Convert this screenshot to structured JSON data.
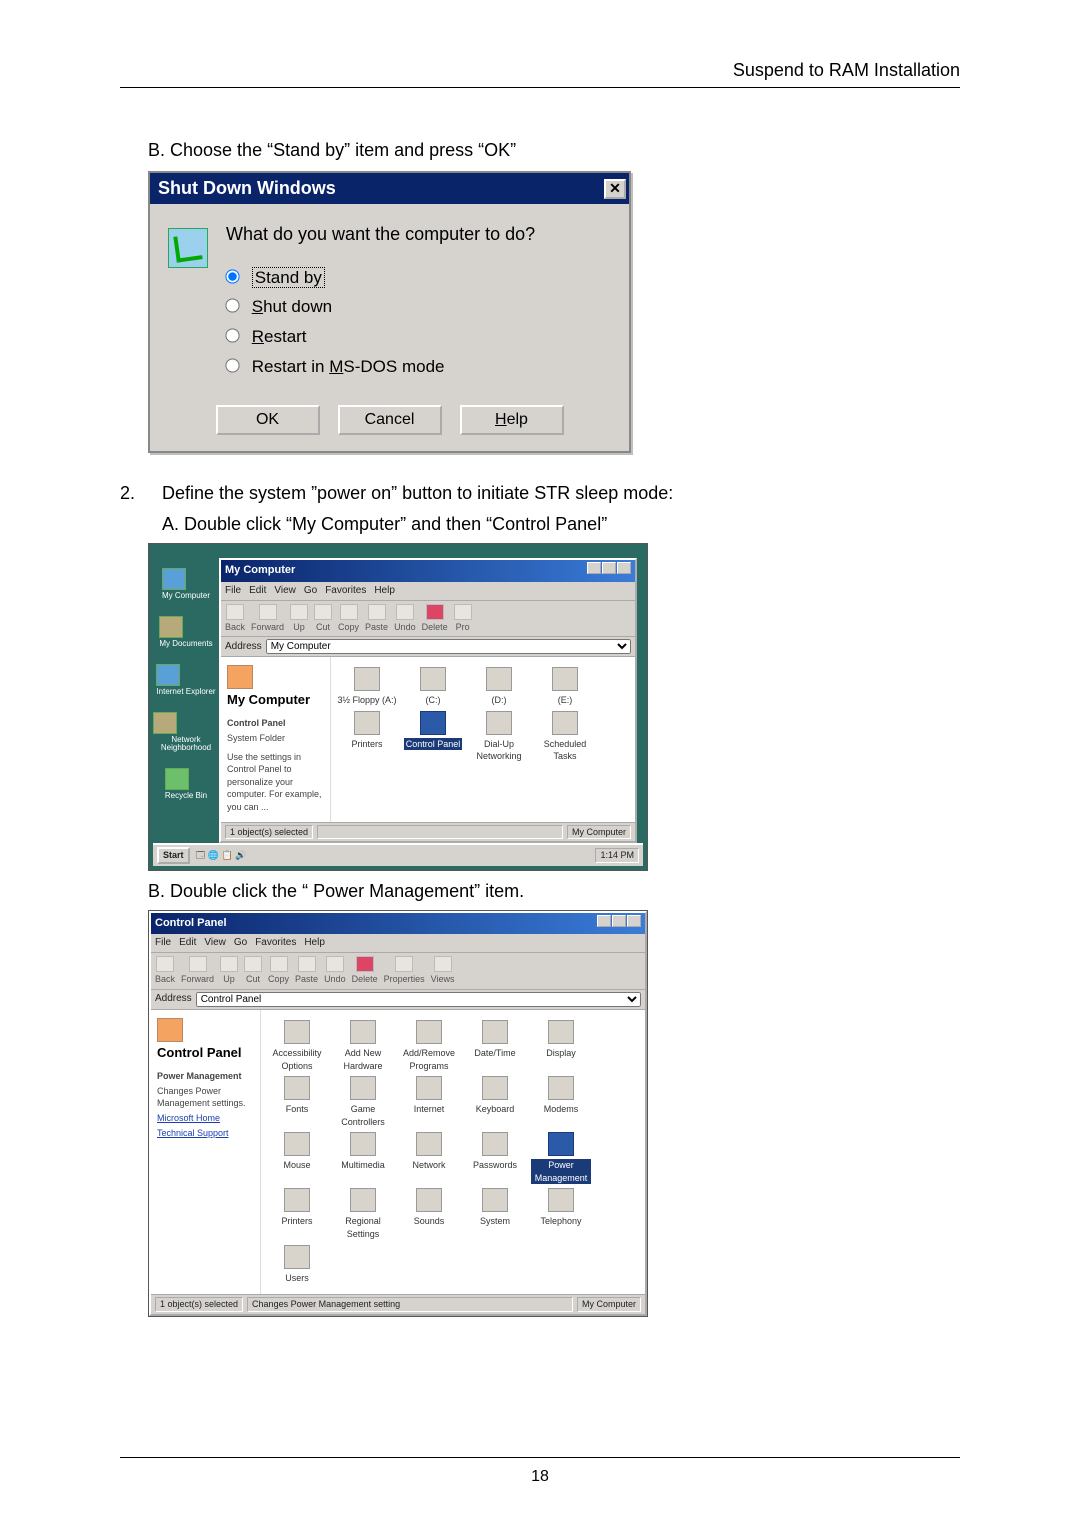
{
  "header": {
    "right": "Suspend to RAM Installation"
  },
  "step_b": "B.  Choose the “Stand by” item and press “OK”",
  "shutdown": {
    "title": "Shut Down Windows",
    "question": "What do you want the computer to do?",
    "opt_standby_plain": "Stand by",
    "opt_shutdown_pre": "S",
    "opt_shutdown_rest": "hut down",
    "opt_restart_pre": "R",
    "opt_restart_rest": "estart",
    "opt_msdos_pre": "Restart in ",
    "opt_msdos_u": "M",
    "opt_msdos_rest": "S-DOS mode",
    "btn_ok": "OK",
    "btn_cancel": "Cancel",
    "btn_help_pre": "H",
    "btn_help_rest": "elp"
  },
  "step2": {
    "num": "2.",
    "text": "Define the system ”power on” button to initiate STR sleep mode:",
    "a": "A.  Double click “My Computer” and then “Control Panel”"
  },
  "mycomp": {
    "title": "My Computer",
    "menus": [
      "File",
      "Edit",
      "View",
      "Go",
      "Favorites",
      "Help"
    ],
    "tools": [
      "Back",
      "Forward",
      "Up",
      "Cut",
      "Copy",
      "Paste",
      "Undo",
      "Delete",
      "Pro"
    ],
    "address_label": "Address",
    "address_value": "My Computer",
    "side_title": "My Computer",
    "side_section": "Control Panel",
    "side_section_sub": "System Folder",
    "side_desc": "Use the settings in Control Panel to personalize your computer. For example, you can ...",
    "items": [
      {
        "label": "3½ Floppy (A:)"
      },
      {
        "label": "(C:)"
      },
      {
        "label": "(D:)"
      },
      {
        "label": "(E:)"
      },
      {
        "label": "Printers"
      },
      {
        "label": "Control Panel",
        "sel": true
      },
      {
        "label": "Dial-Up Networking"
      },
      {
        "label": "Scheduled Tasks"
      }
    ],
    "status_left": "1 object(s) selected",
    "status_right": "My Computer"
  },
  "sec_b2": "B.  Double click the “ Power Management” item.",
  "cpanel": {
    "title": "Control Panel",
    "menus": [
      "File",
      "Edit",
      "View",
      "Go",
      "Favorites",
      "Help"
    ],
    "tools": [
      "Back",
      "Forward",
      "Up",
      "Cut",
      "Copy",
      "Paste",
      "Undo",
      "Delete",
      "Properties",
      "Views"
    ],
    "address_label": "Address",
    "address_value": "Control Panel",
    "side_title": "Control Panel",
    "side_section": "Power Management",
    "side_desc": "Changes Power Management settings.",
    "side_links": [
      "Microsoft Home",
      "Technical Support"
    ],
    "items": [
      {
        "label": "Accessibility Options"
      },
      {
        "label": "Add New Hardware"
      },
      {
        "label": "Add/Remove Programs"
      },
      {
        "label": "Date/Time"
      },
      {
        "label": "Display"
      },
      {
        "label": "Fonts"
      },
      {
        "label": "Game Controllers"
      },
      {
        "label": "Internet"
      },
      {
        "label": "Keyboard"
      },
      {
        "label": "Modems"
      },
      {
        "label": "Mouse"
      },
      {
        "label": "Multimedia"
      },
      {
        "label": "Network"
      },
      {
        "label": "Passwords"
      },
      {
        "label": "Power Management",
        "sel": true
      },
      {
        "label": "Printers"
      },
      {
        "label": "Regional Settings"
      },
      {
        "label": "Sounds"
      },
      {
        "label": "System"
      },
      {
        "label": "Telephony"
      },
      {
        "label": "Users"
      }
    ],
    "status_left": "1 object(s) selected",
    "status_mid": "Changes Power Management setting",
    "status_right": "My Computer"
  },
  "taskbar": {
    "start": "Start",
    "tray": "1:14 PM"
  },
  "page_number": "18"
}
